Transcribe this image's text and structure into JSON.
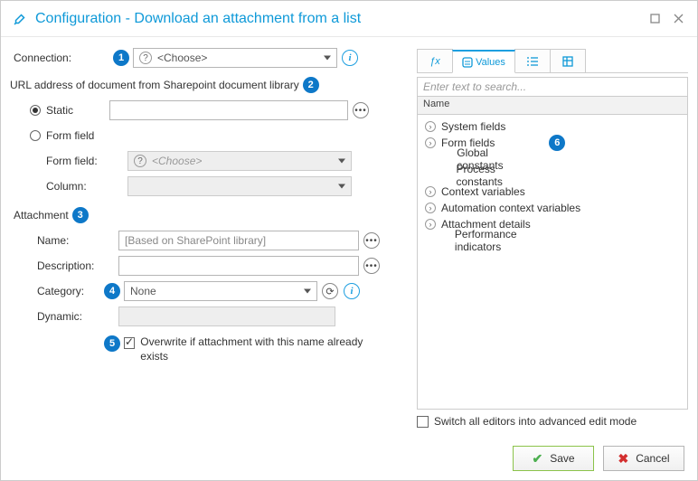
{
  "window": {
    "title": "Configuration - Download an attachment from a list"
  },
  "left": {
    "connection_label": "Connection:",
    "connection_choose": "<Choose>",
    "url_section_label": "URL address of document from Sharepoint document library",
    "static_label": "Static",
    "formfield_label": "Form field",
    "formfield_field_label": "Form field:",
    "formfield_field_choose": "<Choose>",
    "column_label": "Column:",
    "attachment_label": "Attachment",
    "name_label": "Name:",
    "name_placeholder": "[Based on SharePoint library]",
    "description_label": "Description:",
    "category_label": "Category:",
    "category_value": "None",
    "dynamic_label": "Dynamic:",
    "overwrite_label": "Overwrite if attachment with this name already exists"
  },
  "badges": {
    "b1": "1",
    "b2": "2",
    "b3": "3",
    "b4": "4",
    "b5": "5",
    "b6": "6"
  },
  "right": {
    "tab_values": "Values",
    "search_placeholder": "Enter text to search...",
    "header_name": "Name",
    "nodes": {
      "system_fields": "System fields",
      "form_fields": "Form fields",
      "global_constants": "Global constants",
      "process_constants": "Process constants",
      "context_vars": "Context variables",
      "auto_context_vars": "Automation context variables",
      "attachment_details": "Attachment details",
      "perf_indicators": "Performance indicators"
    },
    "switch_label": "Switch all editors into advanced edit mode"
  },
  "footer": {
    "save": "Save",
    "cancel": "Cancel"
  }
}
